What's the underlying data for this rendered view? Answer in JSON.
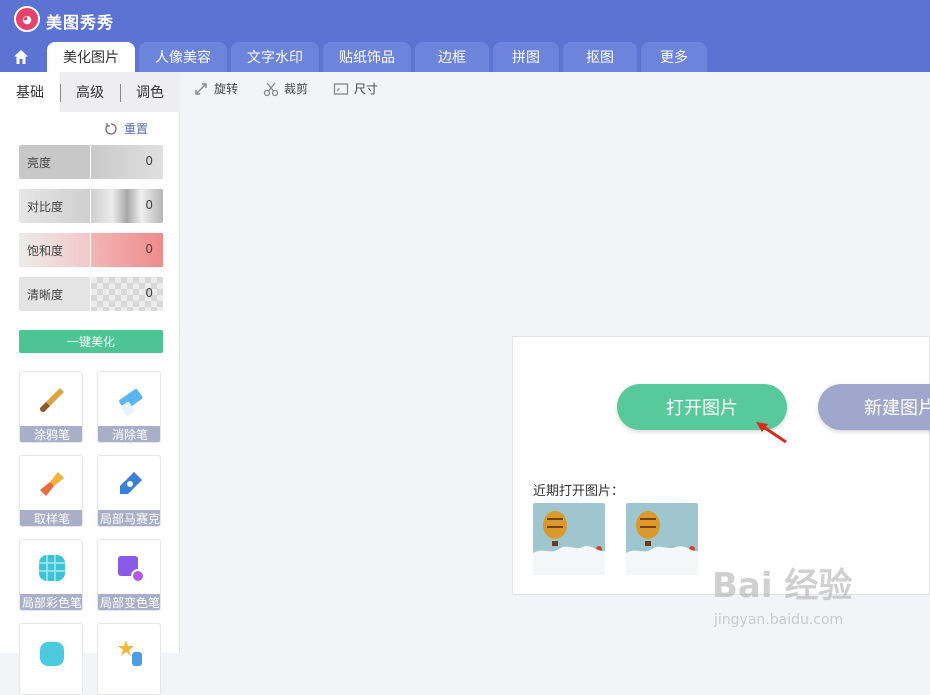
{
  "app": {
    "title": "美图秀秀"
  },
  "tabs": [
    {
      "label": "美化图片"
    },
    {
      "label": "人像美容"
    },
    {
      "label": "文字水印"
    },
    {
      "label": "贴纸饰品"
    },
    {
      "label": "边框"
    },
    {
      "label": "拼图"
    },
    {
      "label": "抠图"
    },
    {
      "label": "更多"
    }
  ],
  "subtabs": [
    {
      "label": "基础"
    },
    {
      "label": "高级"
    },
    {
      "label": "调色"
    }
  ],
  "reset_label": "重置",
  "sliders": [
    {
      "label": "亮度",
      "value": "0"
    },
    {
      "label": "对比度",
      "value": "0"
    },
    {
      "label": "饱和度",
      "value": "0"
    },
    {
      "label": "清晰度",
      "value": "0"
    }
  ],
  "beautify_label": "一键美化",
  "tools": [
    {
      "label": "涂鸦笔",
      "icon": "brush-icon"
    },
    {
      "label": "消除笔",
      "icon": "eraser-icon"
    },
    {
      "label": "取样笔",
      "icon": "sampling-brush-icon"
    },
    {
      "label": "局部马赛克",
      "icon": "mosaic-pen-icon"
    },
    {
      "label": "局部彩色笔",
      "icon": "color-pen-icon"
    },
    {
      "label": "局部变色笔",
      "icon": "recolor-pen-icon"
    }
  ],
  "toolbar": {
    "rotate": "旋转",
    "crop": "裁剪",
    "size": "尺寸"
  },
  "panel": {
    "open_label": "打开图片",
    "new_label": "新建图片",
    "recent_label": "近期打开图片："
  },
  "watermark": {
    "main": "Bai 经验",
    "sub": "jingyan.baidu.com"
  },
  "colors": {
    "brand": "#5b73d2",
    "accent": "#58c99b",
    "secondary": "#9fa8cc"
  }
}
